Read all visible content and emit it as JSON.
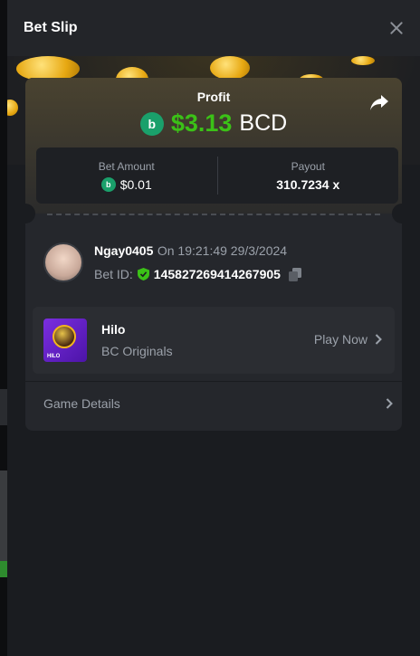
{
  "header": {
    "title": "Bet Slip"
  },
  "profit": {
    "label": "Profit",
    "value": "$3.13",
    "currency": "BCD"
  },
  "stats": {
    "bet_amount_label": "Bet Amount",
    "bet_amount": "$0.01",
    "payout_label": "Payout",
    "payout": "310.7234 x"
  },
  "user": {
    "name": "Ngay0405",
    "time": "On 19:21:49 29/3/2024",
    "bet_id_label": "Bet ID:",
    "bet_id": "145827269414267905"
  },
  "game": {
    "name": "Hilo",
    "provider": "BC Originals",
    "play_label": "Play Now",
    "thumb_label": "HILO"
  },
  "details": {
    "label": "Game Details"
  },
  "colors": {
    "profit": "#3bc117",
    "coin": "#1aa06b",
    "background": "#1a1c20",
    "card": "#25272c"
  },
  "icons": [
    "close-icon",
    "share-icon",
    "bcd-coin-icon",
    "verified-shield-icon",
    "copy-icon",
    "chevron-right-icon"
  ]
}
